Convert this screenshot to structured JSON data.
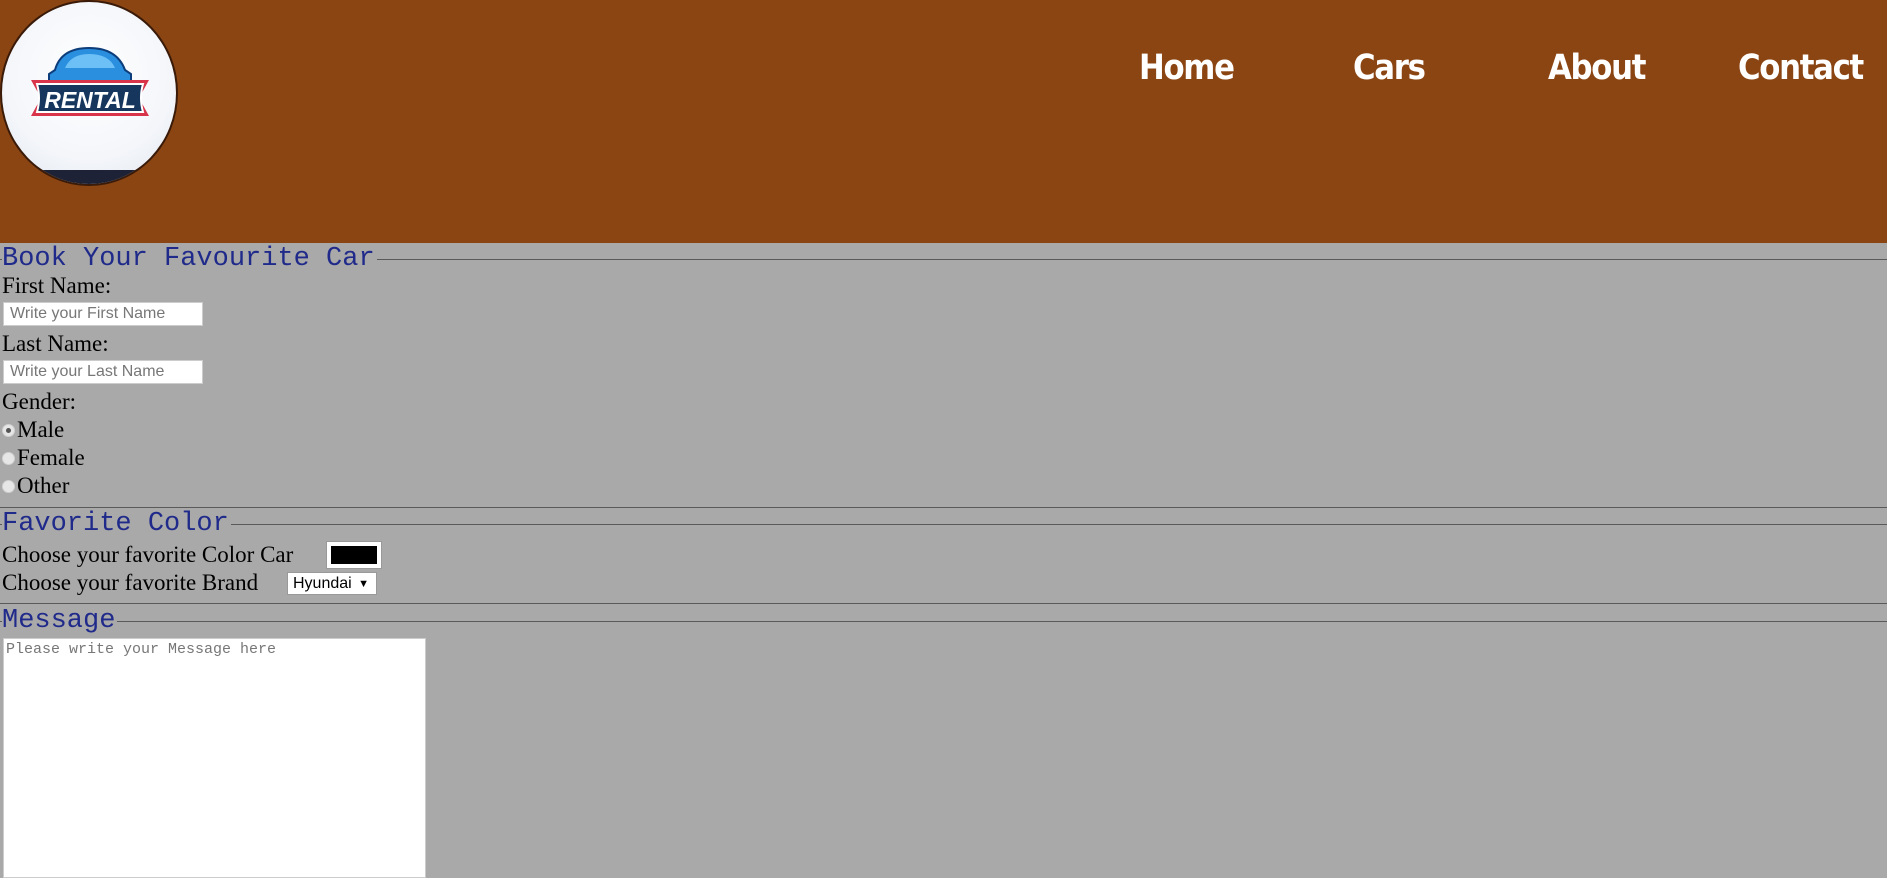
{
  "header": {
    "logo_text": "RENTAL",
    "nav": [
      {
        "label": "Home"
      },
      {
        "label": "Cars"
      },
      {
        "label": "About"
      },
      {
        "label": "Contact"
      }
    ]
  },
  "booking": {
    "legend": "Book Your Favourite Car",
    "first_name_label": "First Name:",
    "first_name_placeholder": "Write your First Name",
    "last_name_label": "Last Name:",
    "last_name_placeholder": "Write your Last Name",
    "gender_label": "Gender:",
    "gender_options": [
      "Male",
      "Female",
      "Other"
    ],
    "gender_selected": "Male"
  },
  "favorite": {
    "legend": "Favorite Color",
    "color_label": "Choose your favorite Color Car",
    "color_value": "#000000",
    "brand_label": "Choose your favorite Brand",
    "brand_selected": "Hyundai"
  },
  "message": {
    "legend": "Message",
    "placeholder": "Please write your Message here"
  },
  "colors": {
    "header_bg": "#8b4513",
    "page_bg": "#a9a9a9",
    "legend_color": "#1f2a8a"
  }
}
